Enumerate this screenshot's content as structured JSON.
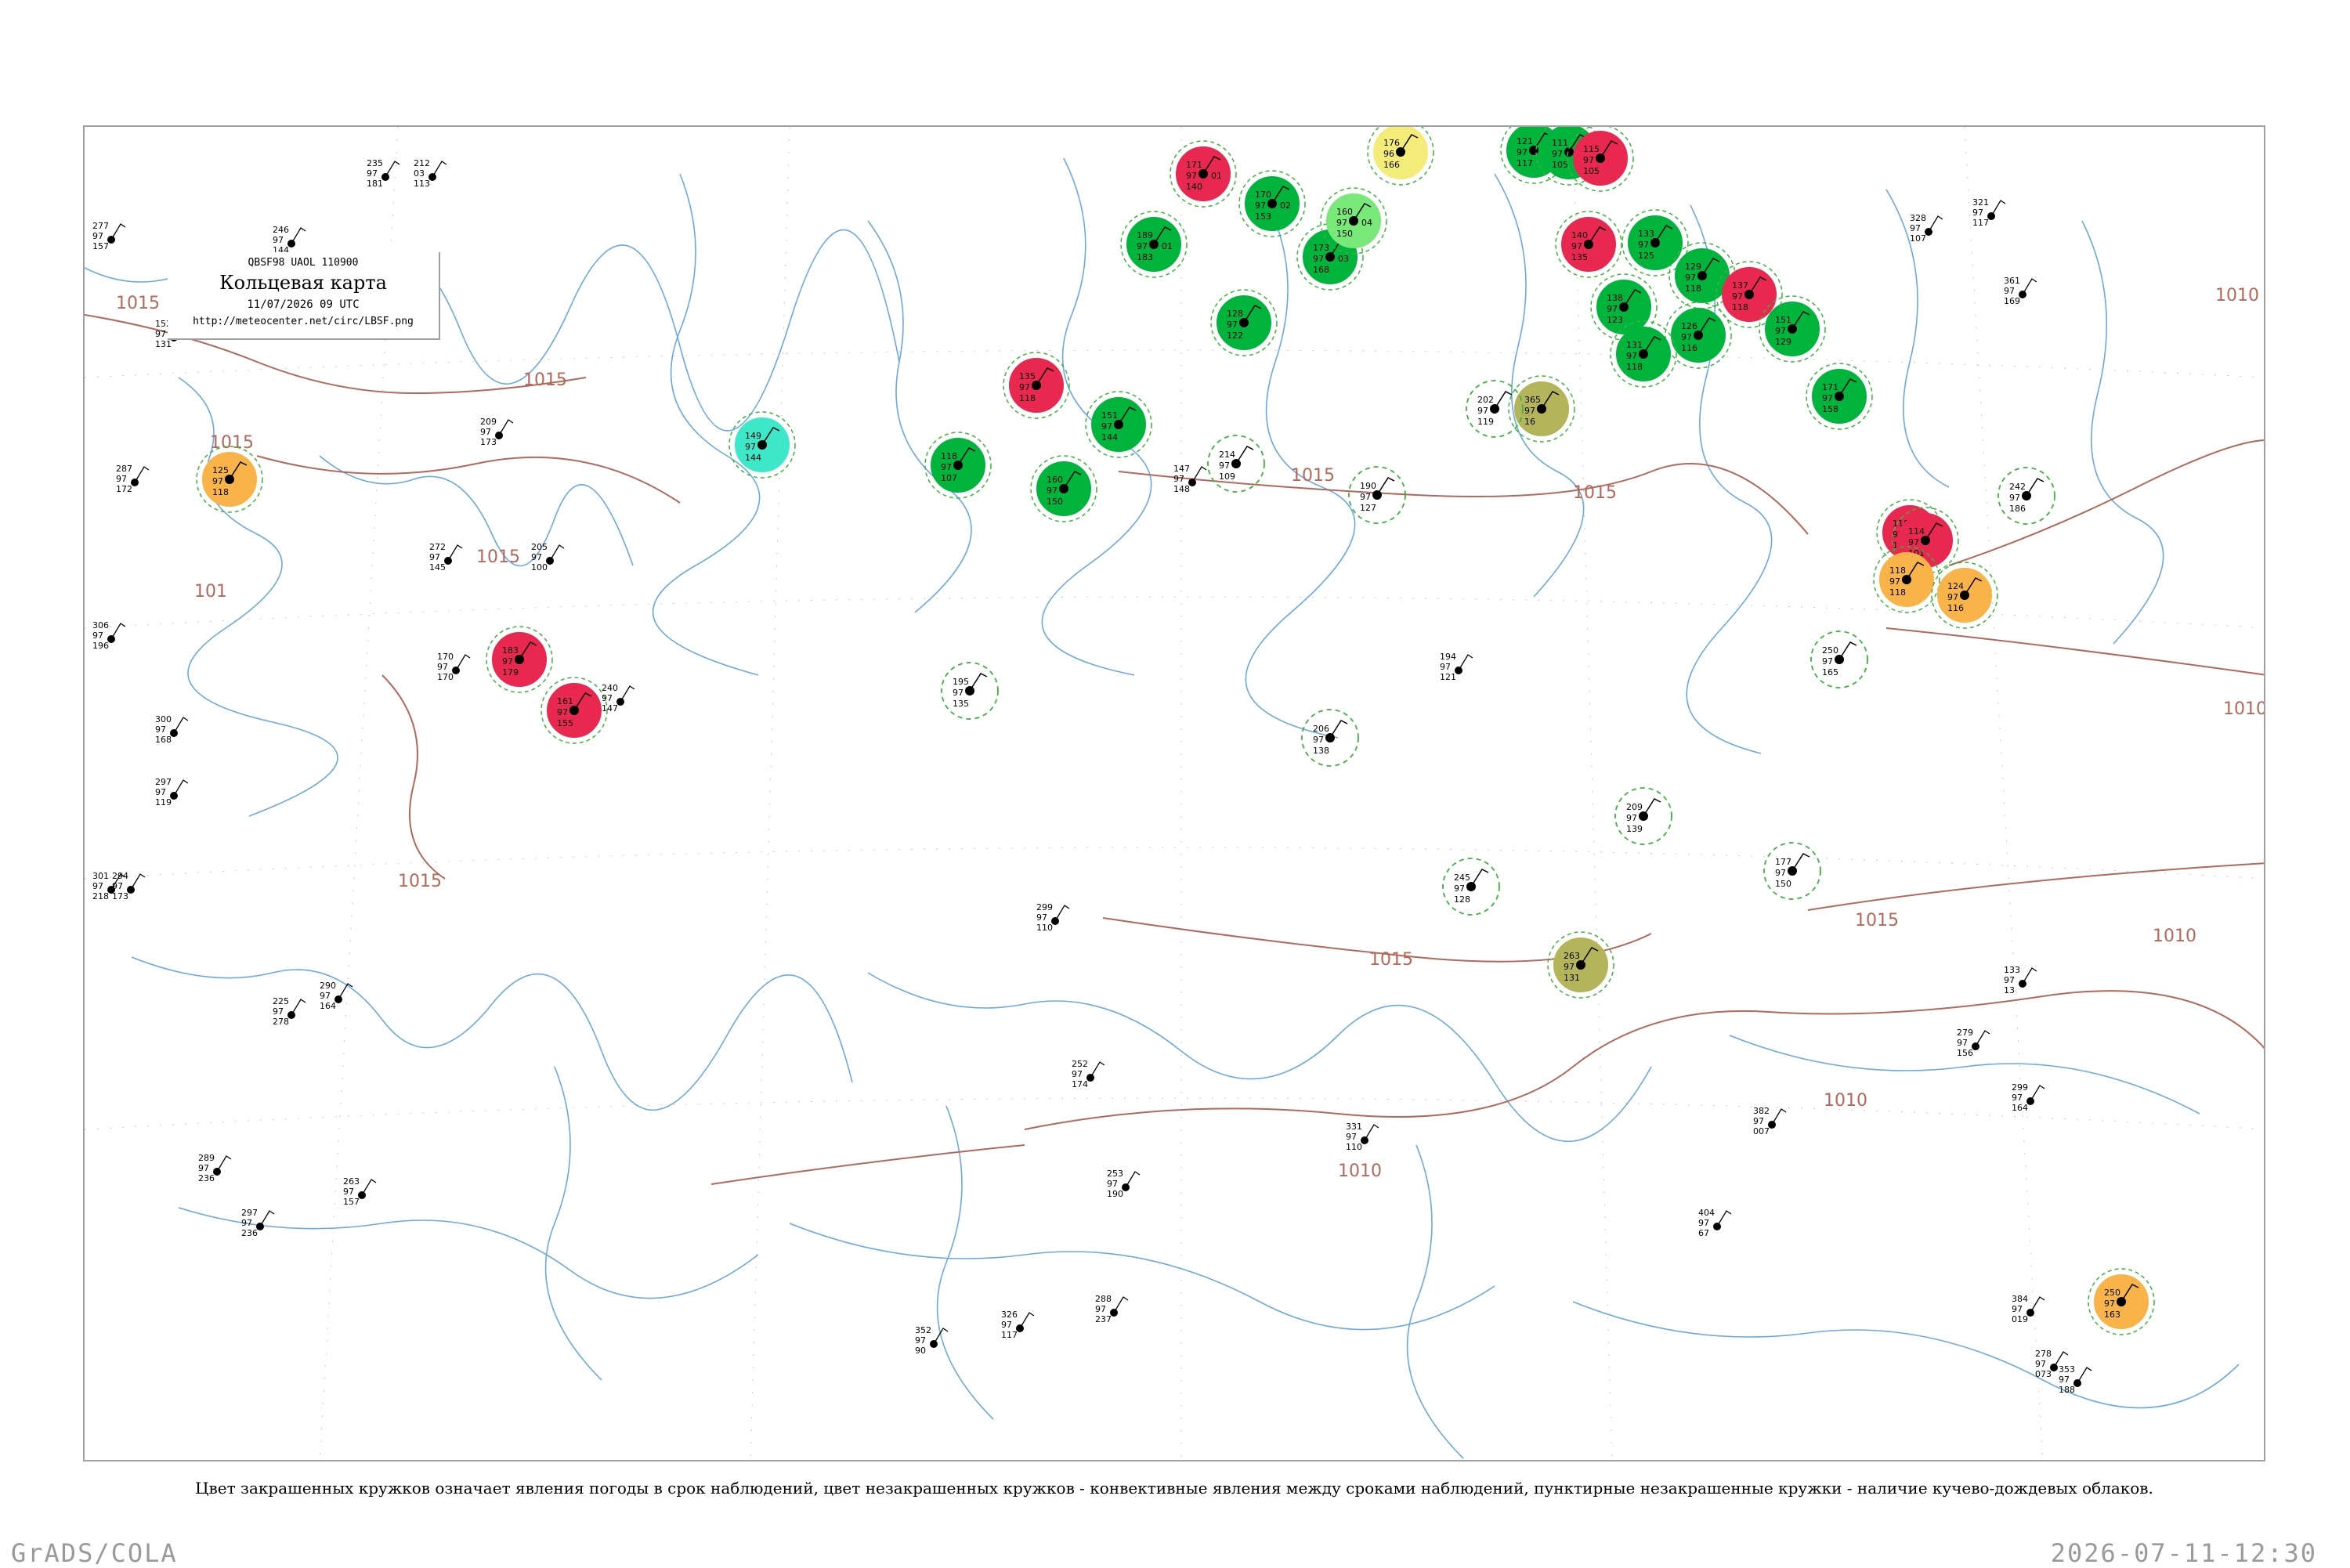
{
  "header": {
    "code": "QBSF98  UAOL  110900",
    "title": "Кольцевая карта",
    "datetime": "11/07/2026 09 UTC",
    "url": "http://meteocenter.net/circ/LBSF.png"
  },
  "legend_text": "Цвет закрашенных кружков означает явления погоды в срок наблюдений, цвет незакрашенных кружков - конвективные явления между сроками наблюдений, пунктирные незакрашенные кружки - наличие кучево-дождевых облаков.",
  "footer": {
    "credit": "GrADS/COLA",
    "timestamp": "2026-07-11-12:30"
  },
  "colors": {
    "coast": "#6aa8e6",
    "isobar": "#b3685a",
    "green": "#00b43c",
    "red": "#e8284f",
    "cyan": "#3ce8c8",
    "light_green": "#78e878",
    "yellow": "#f4ec78",
    "orange": "#f8b448",
    "olive": "#b4b45a",
    "dashed_ring": "#3cb43c"
  },
  "isobar_labels": [
    "1015",
    "1015",
    "1015",
    "1015",
    "1015",
    "1015",
    "1010",
    "1010",
    "1010",
    "1010",
    "1010",
    "1015",
    "1015",
    "101",
    "1015"
  ],
  "stations": [
    {
      "p": "171",
      "t": "97",
      "d": "140",
      "w": "01",
      "color": "red",
      "fill": true
    },
    {
      "p": "189",
      "t": "97",
      "d": "183",
      "w": "01",
      "color": "green",
      "fill": true
    },
    {
      "p": "170",
      "t": "97",
      "d": "153",
      "w": "02",
      "color": "green",
      "fill": true
    },
    {
      "p": "176",
      "t": "96",
      "d": "166",
      "w": "",
      "color": "yellow",
      "fill": true
    },
    {
      "p": "173",
      "t": "97",
      "d": "168",
      "w": "03",
      "color": "green",
      "fill": true
    },
    {
      "p": "160",
      "t": "97",
      "d": "150",
      "w": "04",
      "color": "light_green",
      "fill": true
    },
    {
      "p": "121",
      "t": "97",
      "d": "117",
      "w": "",
      "color": "green",
      "fill": true
    },
    {
      "p": "111",
      "t": "97",
      "d": "105",
      "w": "02",
      "color": "green",
      "fill": true
    },
    {
      "p": "115",
      "t": "97",
      "d": "105",
      "w": "",
      "color": "red",
      "fill": true
    },
    {
      "p": "128",
      "t": "97",
      "d": "122",
      "w": "",
      "color": "green",
      "fill": true
    },
    {
      "p": "140",
      "t": "97",
      "d": "135",
      "w": "",
      "color": "red",
      "fill": true
    },
    {
      "p": "133",
      "t": "97",
      "d": "125",
      "w": "",
      "color": "green",
      "fill": true
    },
    {
      "p": "129",
      "t": "97",
      "d": "118",
      "w": "",
      "color": "green",
      "fill": true
    },
    {
      "p": "137",
      "t": "97",
      "d": "118",
      "w": "",
      "color": "red",
      "fill": true
    },
    {
      "p": "138",
      "t": "97",
      "d": "123",
      "w": "",
      "color": "green",
      "fill": true
    },
    {
      "p": "126",
      "t": "97",
      "d": "116",
      "w": "",
      "color": "green",
      "fill": true
    },
    {
      "p": "131",
      "t": "97",
      "d": "118",
      "w": "",
      "color": "green",
      "fill": true
    },
    {
      "p": "151",
      "t": "97",
      "d": "129",
      "w": "",
      "color": "green",
      "fill": true
    },
    {
      "p": "171",
      "t": "97",
      "d": "158",
      "w": "",
      "color": "green",
      "fill": true
    },
    {
      "p": "149",
      "t": "97",
      "d": "144",
      "w": "",
      "color": "cyan",
      "fill": true
    },
    {
      "p": "135",
      "t": "97",
      "d": "118",
      "w": "",
      "color": "red",
      "fill": true
    },
    {
      "p": "118",
      "t": "97",
      "d": "107",
      "w": "",
      "color": "green",
      "fill": true
    },
    {
      "p": "160",
      "t": "97",
      "d": "150",
      "w": "",
      "color": "green",
      "fill": true
    },
    {
      "p": "118",
      "t": "97",
      "d": "101",
      "w": "",
      "color": "red",
      "fill": true
    },
    {
      "p": "183",
      "t": "97",
      "d": "179",
      "w": "",
      "color": "red",
      "fill": true
    },
    {
      "p": "161",
      "t": "97",
      "d": "155",
      "w": "",
      "color": "red",
      "fill": true
    },
    {
      "p": "114",
      "t": "97",
      "d": "101",
      "w": "",
      "color": "red",
      "fill": true
    },
    {
      "p": "118",
      "t": "97",
      "d": "118",
      "w": "",
      "color": "orange",
      "fill": true
    },
    {
      "p": "124",
      "t": "97",
      "d": "116",
      "w": "",
      "color": "orange",
      "fill": true
    },
    {
      "p": "125",
      "t": "97",
      "d": "118",
      "w": "",
      "color": "orange",
      "fill": true
    },
    {
      "p": "250",
      "t": "97",
      "d": "163",
      "w": "",
      "color": "orange",
      "fill": true
    },
    {
      "p": "263",
      "t": "97",
      "d": "131",
      "w": "",
      "color": "olive",
      "fill": true
    },
    {
      "p": "365",
      "t": "97",
      "d": "16",
      "w": "",
      "color": "olive",
      "fill": true
    },
    {
      "p": "151",
      "t": "97",
      "d": "144",
      "w": "",
      "color": "green",
      "fill": true
    },
    {
      "p": "214",
      "t": "97",
      "d": "109",
      "w": "",
      "color": "dashed_ring",
      "fill": false
    },
    {
      "p": "190",
      "t": "97",
      "d": "127",
      "w": "",
      "color": "dashed_ring",
      "fill": false
    },
    {
      "p": "202",
      "t": "97",
      "d": "119",
      "w": "",
      "color": "dashed_ring",
      "fill": false
    },
    {
      "p": "195",
      "t": "97",
      "d": "135",
      "w": "",
      "color": "dashed_ring",
      "fill": false
    },
    {
      "p": "206",
      "t": "97",
      "d": "138",
      "w": "",
      "color": "dashed_ring",
      "fill": false
    },
    {
      "p": "209",
      "t": "97",
      "d": "139",
      "w": "",
      "color": "dashed_ring",
      "fill": false
    },
    {
      "p": "245",
      "t": "97",
      "d": "128",
      "w": "",
      "color": "dashed_ring",
      "fill": false
    },
    {
      "p": "177",
      "t": "97",
      "d": "150",
      "w": "",
      "color": "dashed_ring",
      "fill": false
    },
    {
      "p": "250",
      "t": "97",
      "d": "165",
      "w": "",
      "color": "dashed_ring",
      "fill": false
    },
    {
      "p": "242",
      "t": "97",
      "d": "186",
      "w": "",
      "color": "dashed_ring",
      "fill": false
    }
  ],
  "plain_stations": [
    {
      "p": "235",
      "t": "97",
      "d": "181"
    },
    {
      "p": "212",
      "t": "03",
      "d": "113"
    },
    {
      "p": "277",
      "t": "97",
      "d": "157"
    },
    {
      "p": "246",
      "t": "97",
      "d": "144"
    },
    {
      "p": "152",
      "t": "97",
      "d": "131"
    },
    {
      "p": "287",
      "t": "97",
      "d": "172"
    },
    {
      "p": "272",
      "t": "97",
      "d": "145"
    },
    {
      "p": "306",
      "t": "97",
      "d": "196"
    },
    {
      "p": "300",
      "t": "97",
      "d": "168"
    },
    {
      "p": "297",
      "t": "97",
      "d": "119"
    },
    {
      "p": "301",
      "t": "97",
      "d": "218"
    },
    {
      "p": "294",
      "t": "97",
      "d": "173"
    },
    {
      "p": "290",
      "t": "97",
      "d": "164"
    },
    {
      "p": "225",
      "t": "97",
      "d": "278"
    },
    {
      "p": "289",
      "t": "97",
      "d": "236"
    },
    {
      "p": "297",
      "t": "97",
      "d": "236"
    },
    {
      "p": "263",
      "t": "97",
      "d": "157"
    },
    {
      "p": "209",
      "t": "97",
      "d": "173"
    },
    {
      "p": "170",
      "t": "97",
      "d": "170"
    },
    {
      "p": "205",
      "t": "97",
      "d": "100"
    },
    {
      "p": "240",
      "t": "97",
      "d": "147"
    },
    {
      "p": "147",
      "t": "97",
      "d": "148"
    },
    {
      "p": "194",
      "t": "97",
      "d": "121"
    },
    {
      "p": "299",
      "t": "97",
      "d": "110"
    },
    {
      "p": "252",
      "t": "97",
      "d": "174"
    },
    {
      "p": "253",
      "t": "97",
      "d": "190"
    },
    {
      "p": "288",
      "t": "97",
      "d": "237"
    },
    {
      "p": "326",
      "t": "97",
      "d": "117"
    },
    {
      "p": "352",
      "t": "97",
      "d": "90"
    },
    {
      "p": "331",
      "t": "97",
      "d": "110"
    },
    {
      "p": "382",
      "t": "97",
      "d": "007"
    },
    {
      "p": "404",
      "t": "97",
      "d": "67"
    },
    {
      "p": "384",
      "t": "97",
      "d": "019"
    },
    {
      "p": "278",
      "t": "97",
      "d": "073"
    },
    {
      "p": "353",
      "t": "97",
      "d": "188"
    },
    {
      "p": "299",
      "t": "97",
      "d": "164"
    },
    {
      "p": "133",
      "t": "97",
      "d": "13"
    },
    {
      "p": "279",
      "t": "97",
      "d": "156"
    },
    {
      "p": "321",
      "t": "97",
      "d": "117"
    },
    {
      "p": "328",
      "t": "97",
      "d": "107"
    },
    {
      "p": "361",
      "t": "97",
      "d": "169"
    }
  ]
}
